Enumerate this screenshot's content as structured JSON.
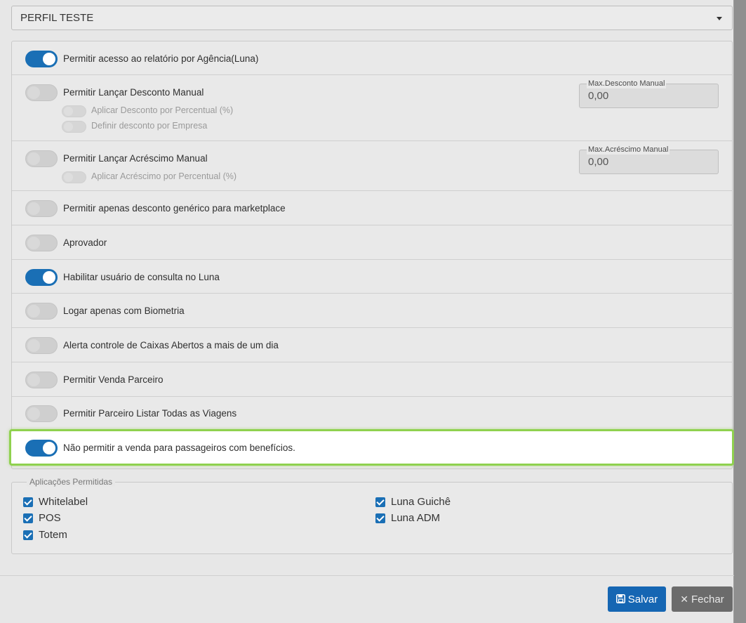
{
  "profile": {
    "selected": "PERFIL TESTE"
  },
  "permissions": {
    "agency_report": {
      "label": "Permitir acesso ao relatório por Agência(Luna)",
      "on": true
    },
    "manual_discount": {
      "label": "Permitir Lançar Desconto Manual",
      "on": false,
      "sub1": "Aplicar Desconto por Percentual (%)",
      "sub2": "Definir desconto por Empresa",
      "field_label": "Max.Desconto Manual",
      "field_value": "0,00"
    },
    "manual_surcharge": {
      "label": "Permitir Lançar Acréscimo Manual",
      "on": false,
      "sub1": "Aplicar Acréscimo por Percentual (%)",
      "field_label": "Max.Acréscimo Manual",
      "field_value": "0,00"
    },
    "generic_discount": {
      "label": "Permitir apenas desconto genérico para marketplace",
      "on": false
    },
    "approver": {
      "label": "Aprovador",
      "on": false
    },
    "query_user": {
      "label": "Habilitar usuário de consulta no Luna",
      "on": true
    },
    "biometry": {
      "label": "Logar apenas com Biometria",
      "on": false
    },
    "open_cash_alert": {
      "label": "Alerta controle de Caixas Abertos a mais de um dia",
      "on": false
    },
    "partner_sale": {
      "label": "Permitir Venda Parceiro",
      "on": false
    },
    "partner_trips": {
      "label": "Permitir Parceiro Listar Todas as Viagens",
      "on": false
    },
    "no_benefit_sale": {
      "label": "Não permitir a venda para passageiros com benefícios.",
      "on": true
    }
  },
  "apps": {
    "legend": "Aplicações Permitidas",
    "items": [
      "Whitelabel",
      "POS",
      "Totem",
      "Luna Guichê",
      "Luna ADM"
    ]
  },
  "footer": {
    "save_label": "Salvar",
    "close_label": "Fechar"
  },
  "colors": {
    "primary": "#1566b3",
    "highlight_border": "#8fd14f",
    "close_button": "#6b6b6b"
  },
  "icons": {
    "save": "floppy-disk-icon",
    "close": "x-icon",
    "select_caret": "caret-down-icon"
  }
}
